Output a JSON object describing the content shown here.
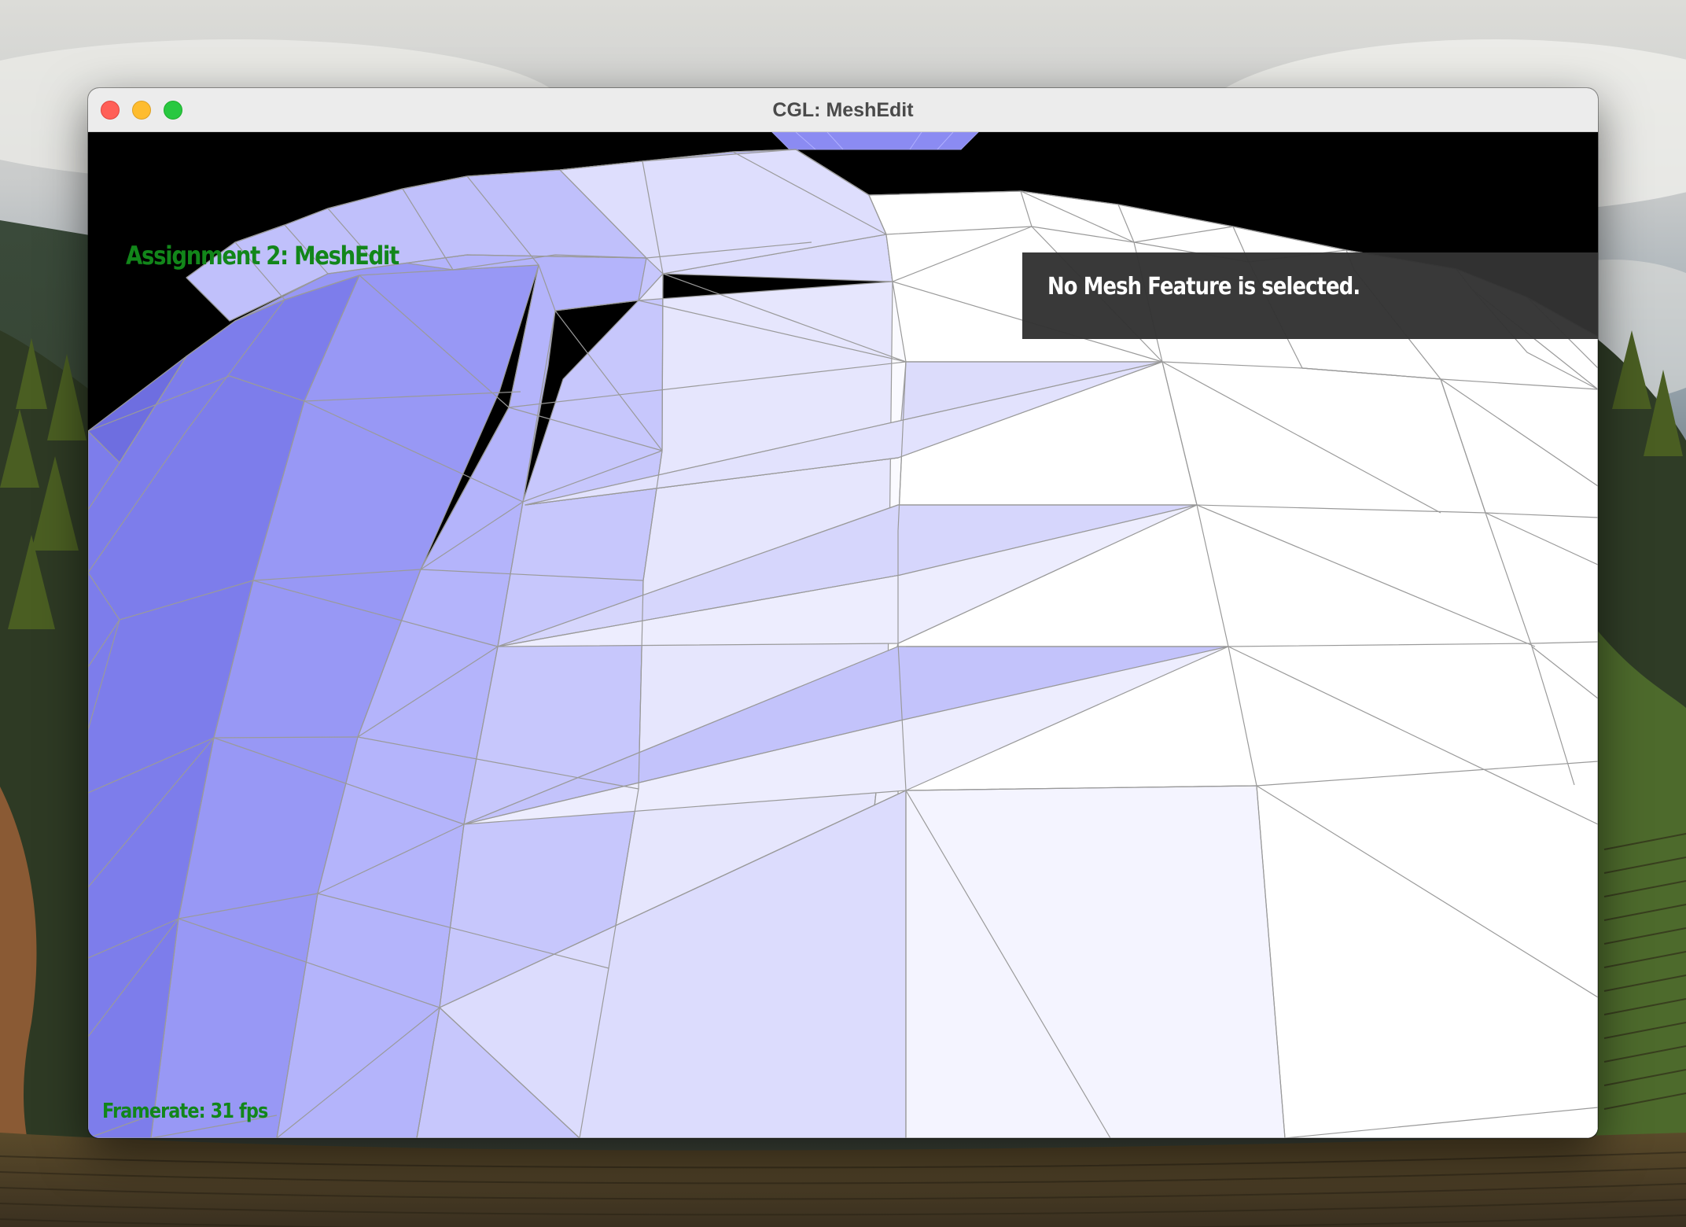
{
  "window": {
    "title": "CGL: MeshEdit"
  },
  "viewport": {
    "assignment_title": "Assignment 2: MeshEdit",
    "selection_status": "No Mesh Feature is selected.",
    "framerate_label": "Framerate: 31 fps"
  },
  "colors": {
    "overlay_text_green": "#12861a",
    "panel_background": "#333333",
    "mesh_shade_dark": "#7b7bea",
    "mesh_shade_light": "#ffffff",
    "mesh_edge": "#9a9a9a"
  },
  "icons": {
    "close": "close-traffic-light",
    "minimize": "minimize-traffic-light",
    "maximize": "maximize-traffic-light"
  }
}
